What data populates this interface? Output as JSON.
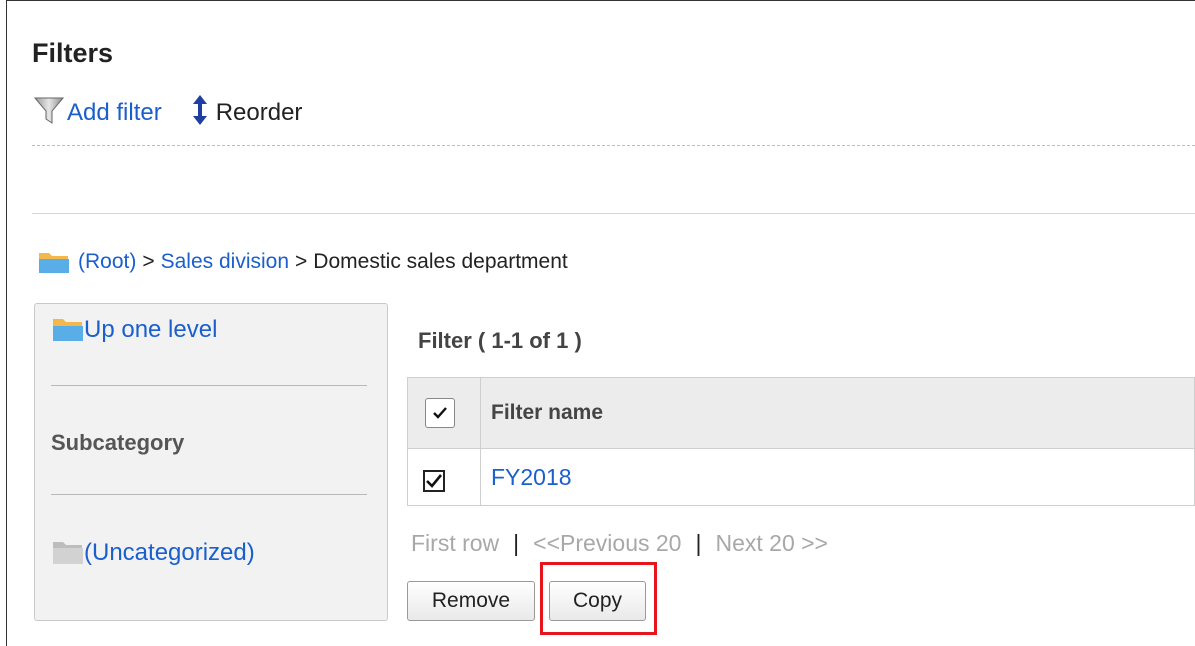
{
  "page": {
    "title": "Filters"
  },
  "toolbar": {
    "add_filter_label": "Add filter",
    "reorder_label": "Reorder",
    "icons": {
      "add_filter": "funnel-icon",
      "reorder": "up-down-arrow-icon"
    }
  },
  "breadcrumb": {
    "root": "(Root)",
    "separator": ">",
    "level1": "Sales division",
    "current": "Domestic sales department"
  },
  "category_panel": {
    "up_one_level": "Up one level",
    "subcategory_heading": "Subcategory",
    "uncategorized": "(Uncategorized)"
  },
  "filter_list": {
    "count_label": "Filter ( 1-1 of 1 )",
    "columns": [
      "Filter name"
    ],
    "rows": [
      {
        "name": "FY2018",
        "checked": true
      }
    ]
  },
  "pagination": {
    "first_row": "First row",
    "previous": "<<Previous 20",
    "next": "Next 20 >>",
    "separator": "|"
  },
  "actions": {
    "remove_label": "Remove",
    "copy_label": "Copy"
  },
  "colors": {
    "link": "#1a5fcc",
    "highlight": "#e8141c",
    "folder": "#5aaee8",
    "folder_tab": "#f2b84b",
    "folder_gray": "#d2d2d2"
  }
}
